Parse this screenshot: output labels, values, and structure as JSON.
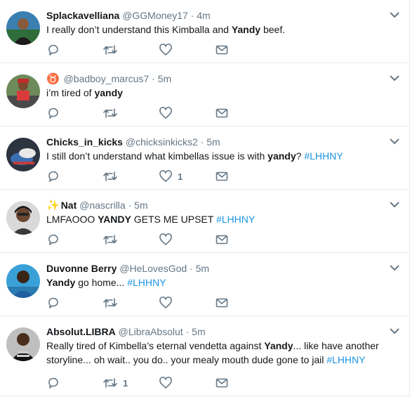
{
  "tweets": [
    {
      "name": "Splackavelliana",
      "handle": "@GGMoney17",
      "time": "4m",
      "text": [
        {
          "t": "I really don’t understand this Kimballa and "
        },
        {
          "t": "Yandy",
          "bold": true
        },
        {
          "t": " beef."
        }
      ],
      "retweets": "",
      "likes": ""
    },
    {
      "name": "",
      "badge": "♉",
      "handle": "@badboy_marcus7",
      "time": "5m",
      "text": [
        {
          "t": "i’m tired of "
        },
        {
          "t": "yandy",
          "bold": true
        }
      ],
      "retweets": "",
      "likes": ""
    },
    {
      "name": "Chicks_in_kicks",
      "handle": "@chicksinkicks2",
      "time": "5m",
      "text": [
        {
          "t": "I still don’t understand what kimbellas issue is with "
        },
        {
          "t": "yandy",
          "bold": true
        },
        {
          "t": "? "
        },
        {
          "t": "#LHHNY",
          "tag": true
        }
      ],
      "retweets": "",
      "likes": "1"
    },
    {
      "name": "Nat",
      "badge": "✨",
      "handle": "@nascrilla",
      "time": "5m",
      "text": [
        {
          "t": "LMFAOOO "
        },
        {
          "t": "YANDY",
          "bold": true
        },
        {
          "t": " GETS ME UPSET "
        },
        {
          "t": "#LHHNY",
          "tag": true
        }
      ],
      "retweets": "",
      "likes": ""
    },
    {
      "name": "Duvonne Berry",
      "handle": "@HeLovesGod",
      "time": "5m",
      "text": [
        {
          "t": "Yandy",
          "bold": true
        },
        {
          "t": " go home... "
        },
        {
          "t": "#LHHNY",
          "tag": true
        }
      ],
      "retweets": "",
      "likes": ""
    },
    {
      "name": "Absolut.LIBRA",
      "handle": "@LibraAbsolut",
      "time": "5m",
      "text": [
        {
          "t": "Really tired of Kimbella’s eternal vendetta against "
        },
        {
          "t": "Yandy",
          "bold": true
        },
        {
          "t": "... like have another storyline... oh wait.. you do.. your mealy mouth dude gone to jail  "
        },
        {
          "t": "#LHHNY",
          "tag": true
        }
      ],
      "retweets": "1",
      "likes": ""
    }
  ],
  "ui": {
    "dot": "·",
    "icon_color": "#657786",
    "hashtag_color": "#1b95e0",
    "divider_color": "#e6ecf0"
  }
}
